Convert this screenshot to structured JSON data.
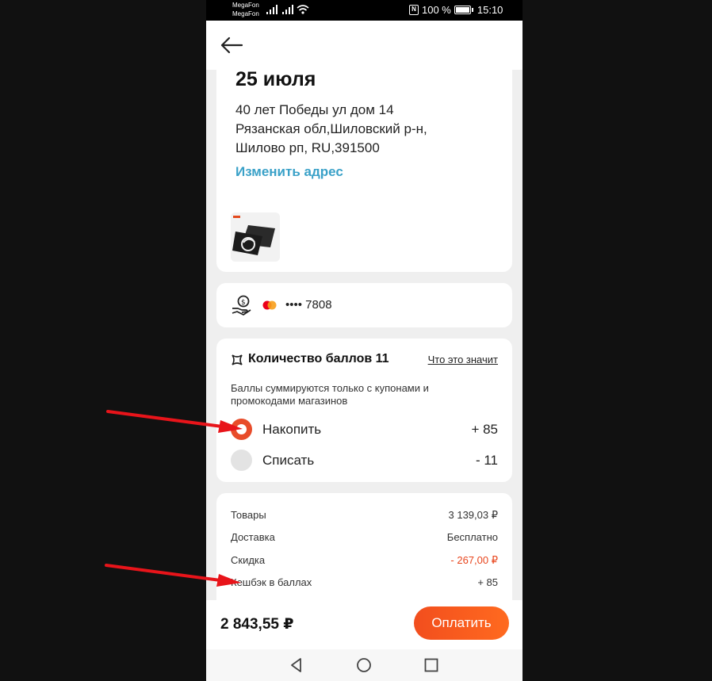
{
  "status": {
    "carrier1": "MegaFon",
    "carrier2": "MegaFon",
    "battery": "100 %",
    "time": "15:10"
  },
  "delivery": {
    "date": "25 июля",
    "address_line1": "40 лет Победы ул дом 14",
    "address_line2": "Рязанская обл,Шиловский р-н,",
    "address_line3": "Шилово рп, RU,391500",
    "change_label": "Изменить адрес"
  },
  "payment": {
    "card_masked": "•••• 7808"
  },
  "points": {
    "title": "Количество баллов 11",
    "link": "Что это значит",
    "note": "Баллы суммируются только с купонами и промокодами магазинов",
    "options": [
      {
        "label": "Накопить",
        "value": "+ 85",
        "selected": true
      },
      {
        "label": "Списать",
        "value": "- 11",
        "selected": false
      }
    ]
  },
  "summary": {
    "rows": [
      {
        "label": "Товары",
        "value": "3 139,03 ₽"
      },
      {
        "label": "Доставка",
        "value": "Бесплатно"
      },
      {
        "label": "Скидка",
        "value": "- 267,00 ₽"
      },
      {
        "label": "Кешбэк в баллах",
        "value": "+ 85"
      }
    ]
  },
  "checkout": {
    "total": "2 843,55 ₽",
    "pay_label": "Оплатить"
  },
  "colors": {
    "accent": "#f24e1e",
    "link": "#3aa1c8",
    "discount": "#e8461e",
    "annotation_arrow": "#e8141a"
  }
}
